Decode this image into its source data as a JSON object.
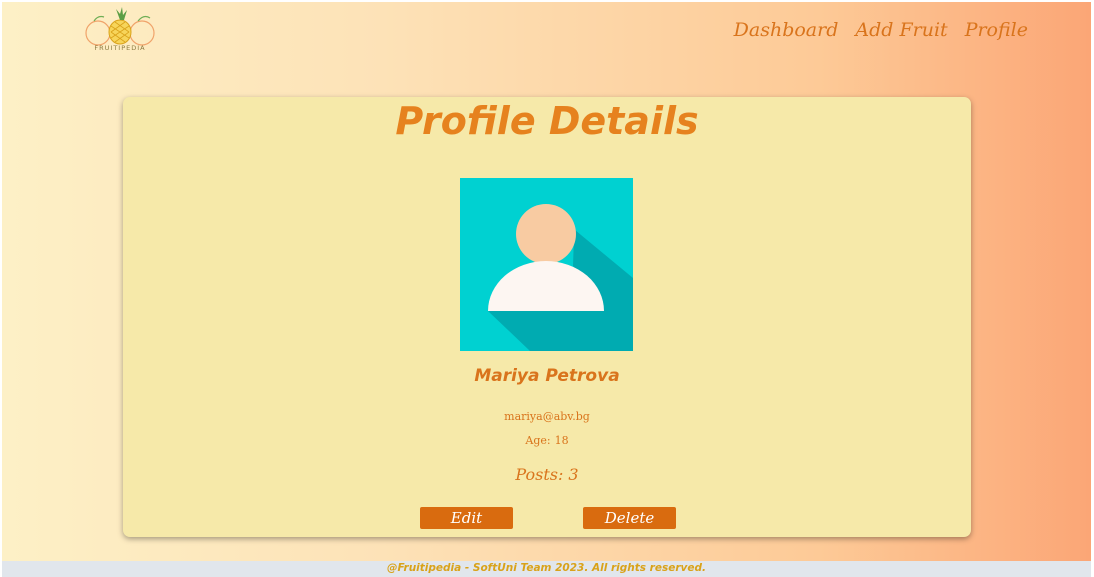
{
  "brand": {
    "logo_text": "FRUITIPEDIA"
  },
  "nav": {
    "items": [
      {
        "label": "Dashboard"
      },
      {
        "label": "Add Fruit"
      },
      {
        "label": "Profile"
      }
    ]
  },
  "profile": {
    "title": "Profile Details",
    "name": "Mariya Petrova",
    "email": "mariya@abv.bg",
    "age_label": "Age:",
    "age": "18",
    "posts_label": "Posts:",
    "posts": "3",
    "edit_label": "Edit",
    "delete_label": "Delete"
  },
  "footer": {
    "text": "@Fruitipedia - SoftUni Team 2023. All rights reserved."
  },
  "colors": {
    "accent": "#d9741c",
    "title": "#e6821e",
    "button": "#d96b0f",
    "card": "#f6e9a9",
    "avatar_bg": "#00d1d1",
    "avatar_shadow": "#00abb1",
    "avatar_head": "#f8cba2",
    "avatar_body": "#fdf6f2"
  },
  "icons": {
    "avatar": "user-avatar-icon",
    "logo": "fruit-logo-icon"
  }
}
